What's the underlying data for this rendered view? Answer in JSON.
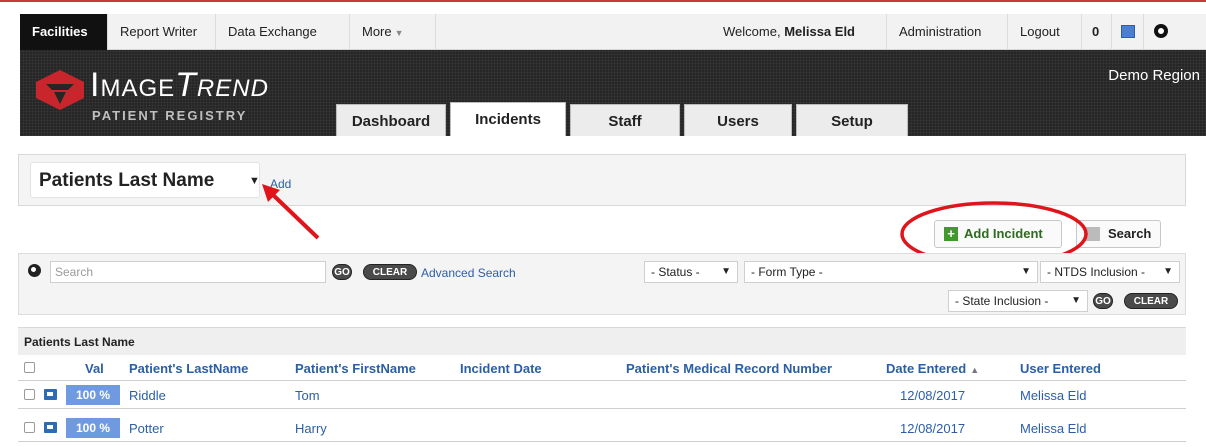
{
  "topnav": {
    "items": [
      "Facilities",
      "Report Writer",
      "Data Exchange",
      "More"
    ],
    "welcome_prefix": "Welcome,",
    "user_name": "Melissa Eld",
    "administration": "Administration",
    "logout": "Logout",
    "count": "0"
  },
  "banner": {
    "logo_main": "Image",
    "logo_italic": "Trend",
    "logo_sub": "PATIENT REGISTRY",
    "region": "Demo Region",
    "tabs": [
      "Dashboard",
      "Incidents",
      "Staff",
      "Users",
      "Setup"
    ],
    "active_tab": "Incidents"
  },
  "view": {
    "title": "Patients Last Name",
    "add_link": "Add"
  },
  "actions": {
    "add_incident": "Add Incident",
    "search": "Search"
  },
  "filters": {
    "search_placeholder": "Search",
    "go": "GO",
    "clear": "CLEAR",
    "advanced_search": "Advanced Search",
    "status": "- Status -",
    "form_type": "- Form Type -",
    "ntds_inclusion": "- NTDS Inclusion -",
    "state_inclusion": "- State Inclusion -"
  },
  "table": {
    "section_title": "Patients Last Name",
    "columns": [
      "Val",
      "Patient's LastName",
      "Patient's FirstName",
      "Incident Date",
      "Patient's Medical Record Number",
      "Date Entered",
      "User Entered"
    ],
    "rows": [
      {
        "val": "100 %",
        "last_name": "Riddle",
        "first_name": "Tom",
        "incident_date": "",
        "mrn": "",
        "date_entered": "12/08/2017",
        "user_entered": "Melissa Eld"
      },
      {
        "val": "100 %",
        "last_name": "Potter",
        "first_name": "Harry",
        "incident_date": "",
        "mrn": "",
        "date_entered": "12/08/2017",
        "user_entered": "Melissa Eld"
      }
    ]
  },
  "colors": {
    "accent_link": "#2a5fa8",
    "annotation_red": "#e0141b",
    "val_badge": "#6f9ae0",
    "add_green": "#3f9a2c"
  }
}
